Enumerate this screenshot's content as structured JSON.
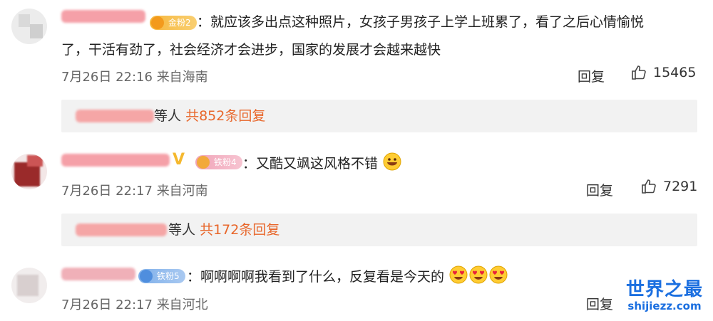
{
  "comments": [
    {
      "fan_badge": "金粉2",
      "text_line1": "：就应该多出点这种照片，女孩子男孩子上学上班累了，看了之后心情愉悦",
      "text_line2": "了，干活有劲了，社会经济才会进步，国家的发展才会越来越快",
      "date": "7月26日 22:16",
      "location": "来自海南",
      "reply_label": "回复",
      "likes": "15465",
      "thread_suffix": "等人",
      "thread_count": "共852条回复"
    },
    {
      "fan_badge": "铁粉4",
      "text": "：又酷又飒这风格不错",
      "date": "7月26日 22:17",
      "location": "来自河南",
      "reply_label": "回复",
      "likes": "7291",
      "thread_suffix": "等人",
      "thread_count": "共172条回复"
    },
    {
      "fan_badge": "铁粉5",
      "text": "：啊啊啊啊我看到了什么，反复看是今天的",
      "date": "7月26日 22:17",
      "location": "来自河北",
      "reply_label": "回复"
    }
  ],
  "watermark": {
    "title": "世界之最",
    "url": "shijiezz.com"
  },
  "icons": {
    "like": "thumbs-up-icon",
    "verified": "verified-v-icon",
    "emoji_grin": "grinning-emoji-icon",
    "emoji_hearteyes": "heart-eyes-emoji-icon"
  },
  "colors": {
    "thread_count": "#e8662a",
    "meta": "#666666",
    "thread_bg": "#f2f2f2",
    "watermark": "#1b6fe0"
  }
}
